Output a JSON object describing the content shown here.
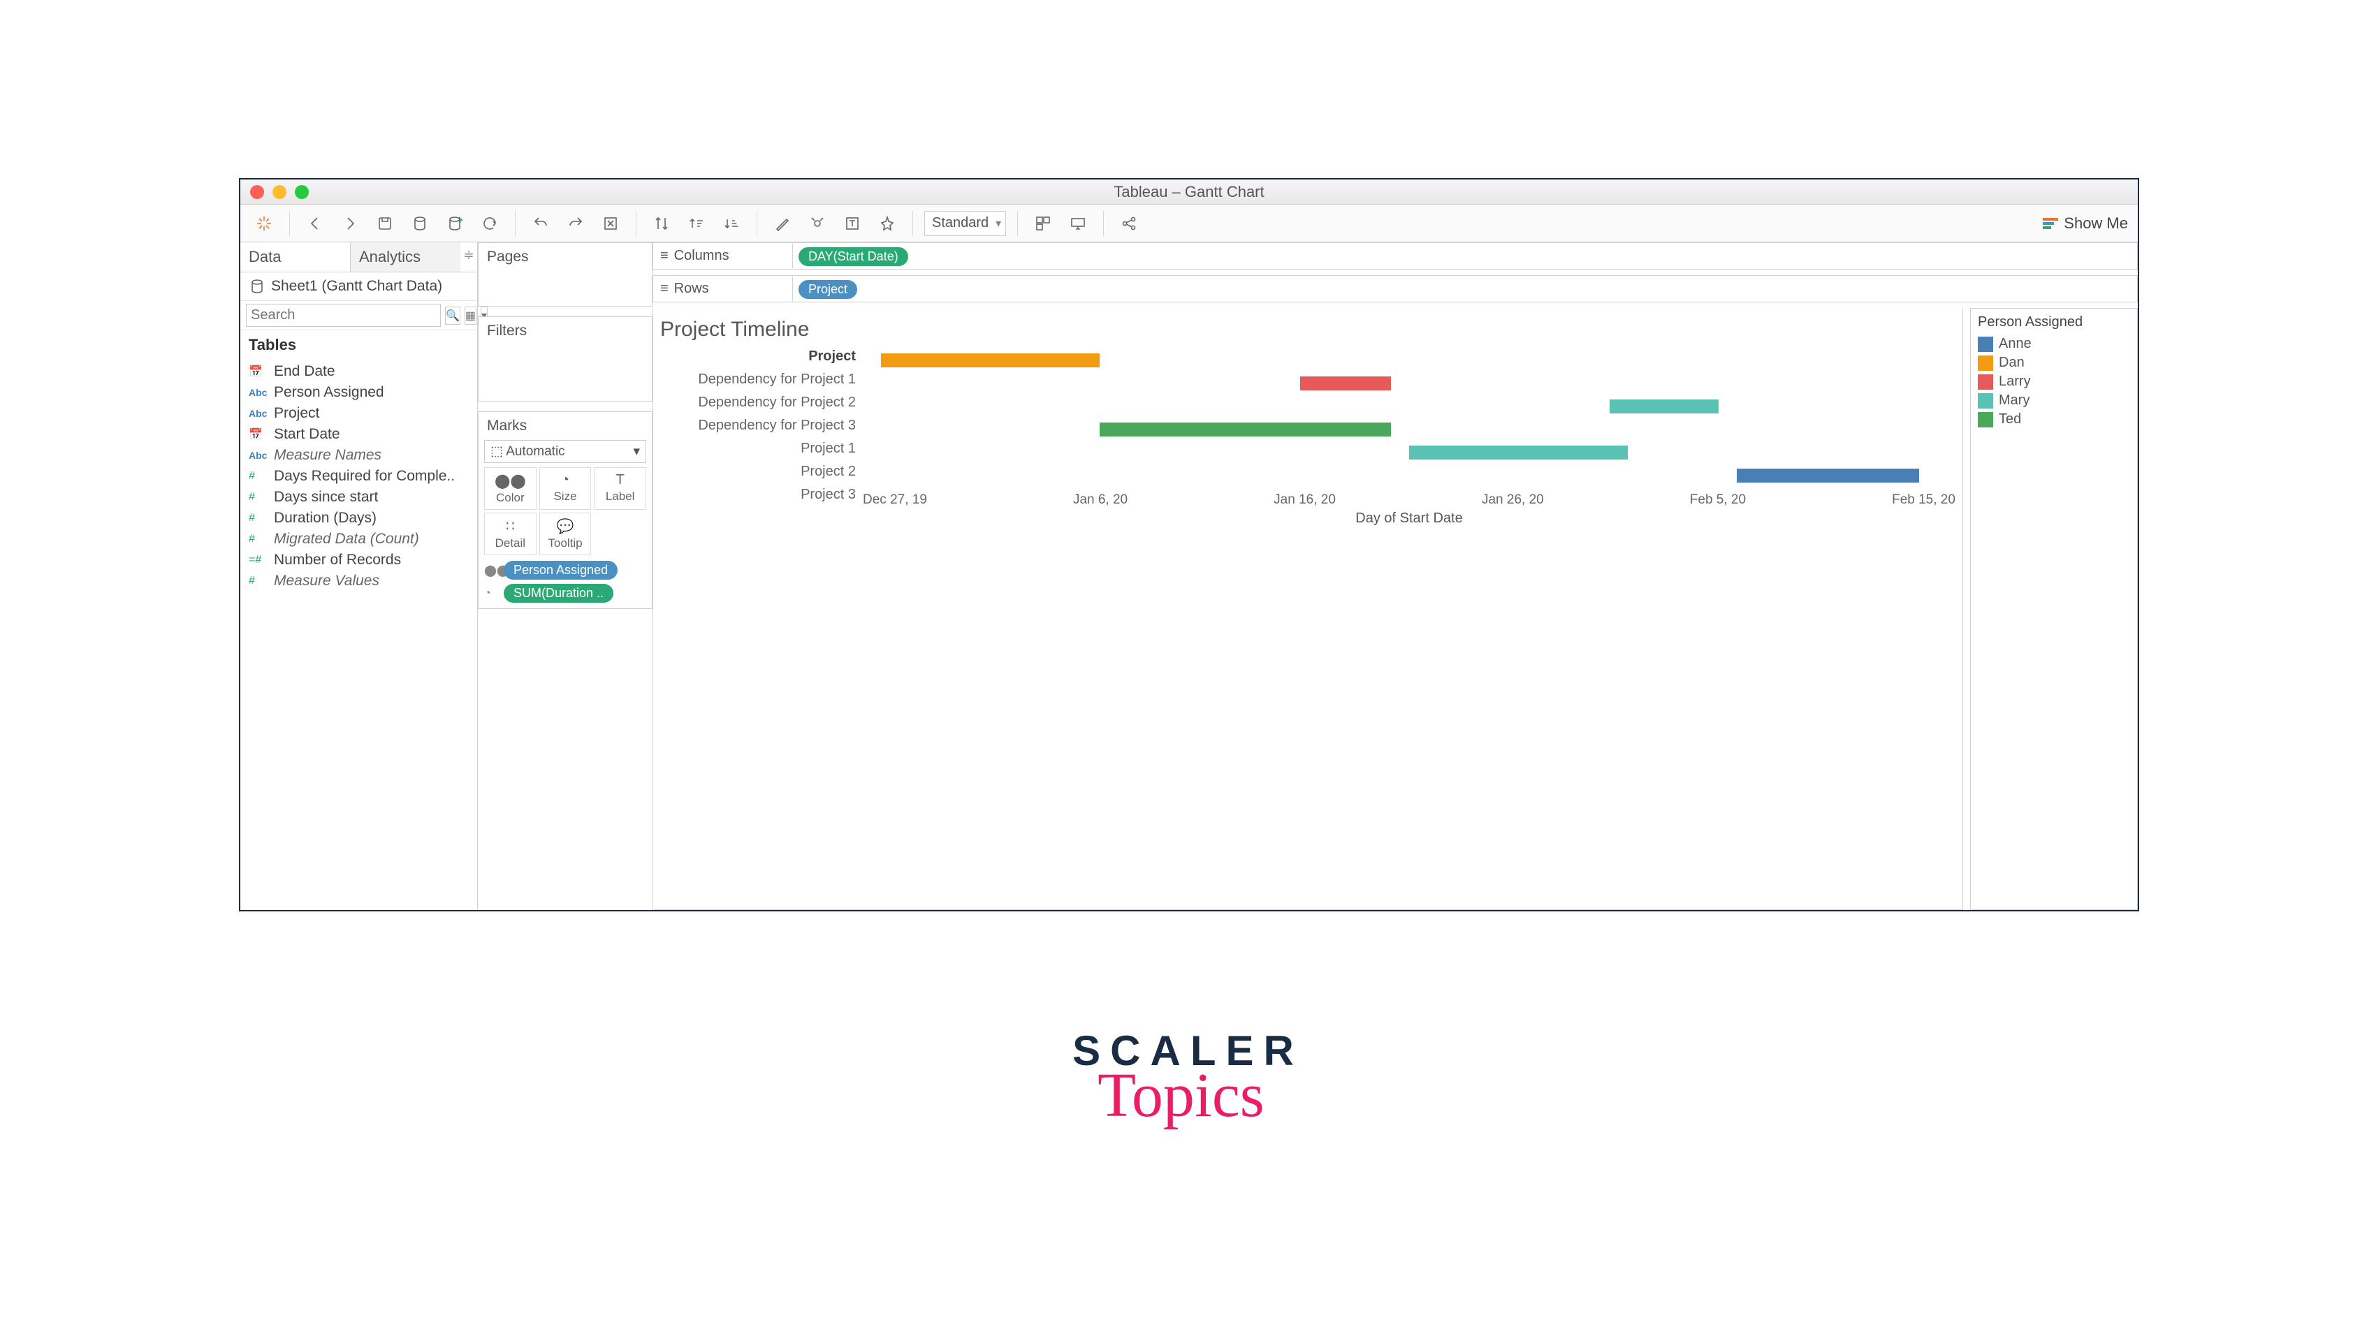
{
  "window": {
    "title": "Tableau – Gantt Chart"
  },
  "toolbar": {
    "fit_mode": "Standard",
    "show_me": "Show Me"
  },
  "data_pane": {
    "tabs": {
      "data": "Data",
      "analytics": "Analytics"
    },
    "sheet_label": "Sheet1 (Gantt Chart Data)",
    "search_placeholder": "Search",
    "tables_header": "Tables",
    "fields": [
      {
        "type": "date",
        "label": "End Date",
        "italic": false
      },
      {
        "type": "abc",
        "label": "Person Assigned",
        "italic": false
      },
      {
        "type": "abc",
        "label": "Project",
        "italic": false
      },
      {
        "type": "date",
        "label": "Start Date",
        "italic": false
      },
      {
        "type": "abc",
        "label": "Measure Names",
        "italic": true
      },
      {
        "type": "hash",
        "label": "Days Required for Comple..",
        "italic": false
      },
      {
        "type": "hash",
        "label": "Days since start",
        "italic": false
      },
      {
        "type": "hash",
        "label": "Duration (Days)",
        "italic": false
      },
      {
        "type": "hash",
        "label": "Migrated Data (Count)",
        "italic": true
      },
      {
        "type": "hasheq",
        "label": "Number of Records",
        "italic": false
      },
      {
        "type": "hash",
        "label": "Measure Values",
        "italic": true
      }
    ]
  },
  "shelves": {
    "pages": "Pages",
    "filters": "Filters",
    "marks": "Marks",
    "marks_type": "Automatic",
    "cells": {
      "color": "Color",
      "size": "Size",
      "label": "Label",
      "detail": "Detail",
      "tooltip": "Tooltip"
    },
    "mark_pills": [
      {
        "icon": "color",
        "label": "Person Assigned",
        "cls": "blue"
      },
      {
        "icon": "size",
        "label": "SUM(Duration ..",
        "cls": "teal"
      }
    ],
    "columns_label": "Columns",
    "rows_label": "Rows",
    "columns_pill": "DAY(Start Date)",
    "rows_pill": "Project"
  },
  "worksheet": {
    "title": "Project Timeline",
    "row_header_title": "Project",
    "x_title": "Day of Start Date"
  },
  "legend": {
    "title": "Person Assigned",
    "items": [
      {
        "name": "Anne",
        "color": "#4a7fb5"
      },
      {
        "name": "Dan",
        "color": "#f39c12"
      },
      {
        "name": "Larry",
        "color": "#e65a5a"
      },
      {
        "name": "Mary",
        "color": "#5ac2b5"
      },
      {
        "name": "Ted",
        "color": "#4aa85a"
      }
    ]
  },
  "chart_data": {
    "type": "bar",
    "orientation": "gantt",
    "x_axis": {
      "label": "Day of Start Date",
      "ticks": [
        "Dec 27, 19",
        "Jan 6, 20",
        "Jan 16, 20",
        "Jan 26, 20",
        "Feb 5, 20",
        "Feb 15, 20"
      ],
      "range_days": [
        0,
        60
      ]
    },
    "categories": [
      "Dependency for Project 1",
      "Dependency for Project 2",
      "Dependency for Project 3",
      "Project 1",
      "Project 2",
      "Project 3"
    ],
    "series": [
      {
        "category": "Dependency for Project 1",
        "start_day": 1,
        "duration": 12,
        "person": "Dan",
        "color": "#f39c12"
      },
      {
        "category": "Dependency for Project 2",
        "start_day": 24,
        "duration": 5,
        "person": "Larry",
        "color": "#e65a5a"
      },
      {
        "category": "Dependency for Project 3",
        "start_day": 41,
        "duration": 6,
        "person": "Mary",
        "color": "#5ac2b5"
      },
      {
        "category": "Project 1",
        "start_day": 13,
        "duration": 16,
        "person": "Ted",
        "color": "#4aa85a"
      },
      {
        "category": "Project 2",
        "start_day": 30,
        "duration": 12,
        "person": "Mary",
        "color": "#5ac2b5"
      },
      {
        "category": "Project 3",
        "start_day": 48,
        "duration": 10,
        "person": "Anne",
        "color": "#4a7fb5"
      }
    ]
  },
  "branding": {
    "line1": "SCALER",
    "line2": "Topics"
  }
}
